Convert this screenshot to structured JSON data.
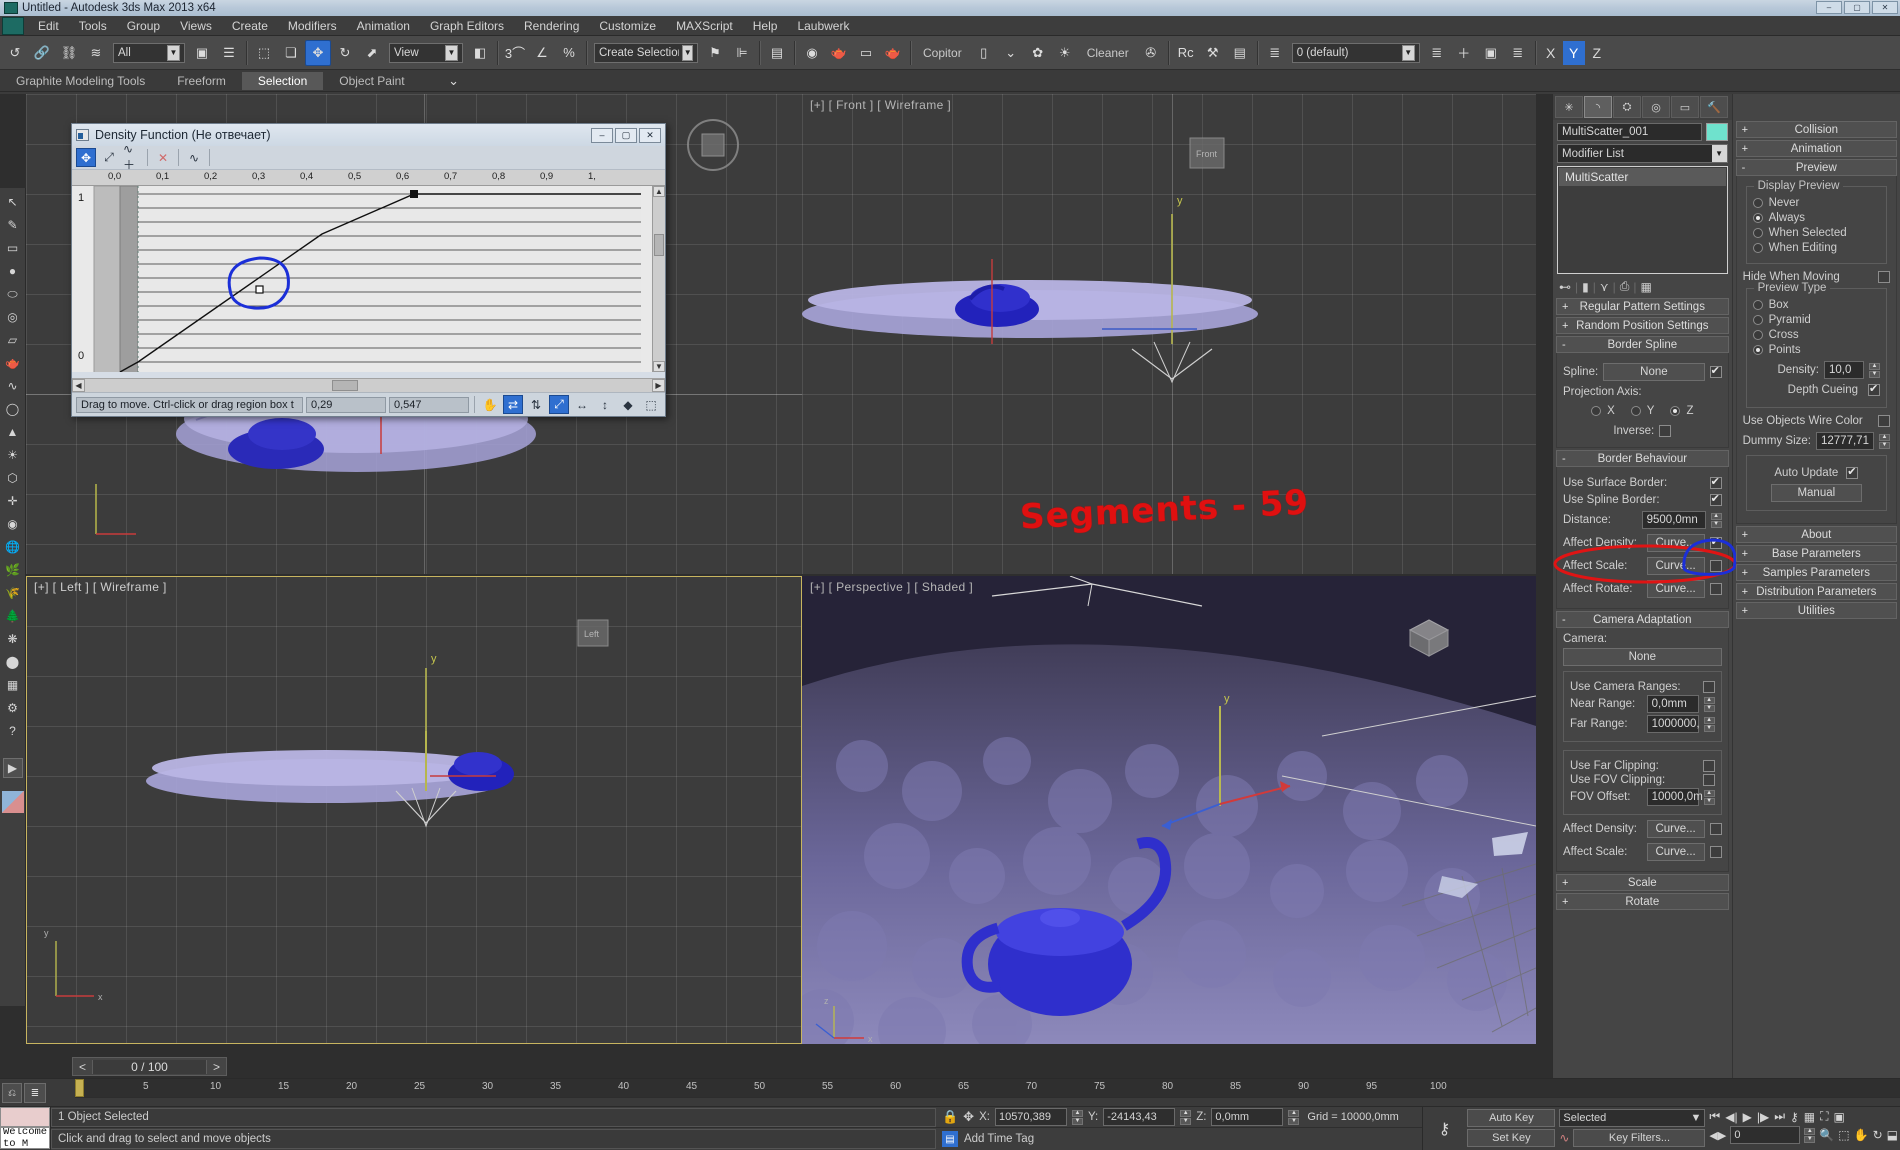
{
  "window": {
    "title": "Untitled - Autodesk 3ds Max  2013 x64",
    "buttons": [
      "–",
      "▢",
      "✕"
    ]
  },
  "menu": {
    "items": [
      "Edit",
      "Tools",
      "Group",
      "Views",
      "Create",
      "Modifiers",
      "Animation",
      "Graph Editors",
      "Rendering",
      "Customize",
      "MAXScript",
      "Help",
      "Laubwerk"
    ]
  },
  "toolbar": {
    "filter_combo": "All",
    "ref_coord_combo": "View",
    "selection_set_combo": "Create Selection Se",
    "layer_combo": "0 (default)",
    "plugin_labels": {
      "copitor": "Copitor",
      "cleaner": "Cleaner"
    },
    "axis": {
      "x": "X",
      "y": "Y",
      "z": "Z"
    },
    "icons": [
      "link-icon",
      "unlink-icon",
      "bind-spacewarp-icon",
      "select-object-icon",
      "select-by-name-icon",
      "rect-select-region-icon",
      "window-crossing-icon",
      "select-move-icon",
      "select-rotate-icon",
      "select-scale-icon",
      "snap-toggle-icon",
      "angle-snap-icon",
      "percent-snap-icon",
      "named-selection-sets-icon",
      "mirror-icon",
      "align-icon",
      "layer-manager-icon",
      "material-editor-icon",
      "render-setup-icon",
      "render-frame-icon",
      "render-production-icon",
      "curve-editor-icon",
      "schematic-view-icon",
      "manage-layers-icon",
      "add-layer-icon",
      "select-layer-icon",
      "layer-properties-icon"
    ]
  },
  "ribbon": {
    "tabs": [
      {
        "label": "Graphite Modeling Tools",
        "selected": false
      },
      {
        "label": "Freeform",
        "selected": false
      },
      {
        "label": "Selection",
        "selected": true
      },
      {
        "label": "Object Paint",
        "selected": false
      }
    ]
  },
  "dialog": {
    "title": "Density Function (Не отвечает)",
    "window_buttons": [
      "–",
      "▢",
      "✕"
    ],
    "toolbar_icons": [
      "move-key-icon",
      "scale-key-icon",
      "add-point-icon",
      "delete-point-icon",
      "apply-curve-icon"
    ],
    "ruler_ticks": [
      "0,0",
      "0,1",
      "0,2",
      "0,3",
      "0,4",
      "0,5",
      "0,6",
      "0,7",
      "0,8",
      "0,9",
      "1,"
    ],
    "y_axis_labels": [
      "1",
      "0"
    ],
    "status_hint": "Drag to move. Ctrl-click or drag region box t",
    "x_value": "0,29",
    "y_value": "0,547",
    "status_icons": [
      "pan-icon",
      "zoom-horizontal-icon",
      "zoom-vertical-icon",
      "zoom-region-icon",
      "frame-horizontal-icon",
      "frame-vertical-icon",
      "zoom-value-icon",
      "zoom-region-box-icon"
    ],
    "curve_points": [
      {
        "x": 0.0,
        "y": 0.0,
        "selected": false
      },
      {
        "x": 0.29,
        "y": 0.547,
        "selected": true
      },
      {
        "x": 0.5,
        "y": 1.0,
        "selected": false
      },
      {
        "x": 1.0,
        "y": 1.0,
        "selected": false
      }
    ]
  },
  "viewports": [
    {
      "name": "top-left",
      "label": "",
      "active": false
    },
    {
      "name": "front",
      "label": "[+] [ Front ] [ Wireframe ]",
      "active": false
    },
    {
      "name": "left",
      "label": "[+] [ Left ] [ Wireframe ]",
      "active": true
    },
    {
      "name": "perspective",
      "label": "[+] [ Perspective ] [ Shaded ]",
      "active": false
    }
  ],
  "annotations": {
    "handwritten_red": "Segments - 59",
    "circle_red_target": "affect-density-row",
    "circle_blue_target": "affect-density-checkbox"
  },
  "command_panel": {
    "tabs": [
      "create-tab",
      "modify-tab",
      "hierarchy-tab",
      "motion-tab",
      "display-tab",
      "utilities-tab"
    ],
    "selected_tab_index": 1,
    "object_name": "MultiScatter_001",
    "object_color": "#6fe2cd",
    "modifier_list_label": "Modifier List",
    "modifier_stack": [
      "MultiScatter"
    ],
    "stack_icons": [
      "pin-stack-icon",
      "show-end-result-icon",
      "make-unique-icon",
      "remove-modifier-icon",
      "configure-modifier-sets-icon"
    ],
    "left_rollups": [
      {
        "label": "Regular Pattern Settings",
        "state": "+"
      },
      {
        "label": "Random Position Settings",
        "state": "+"
      },
      {
        "label": "Border Spline",
        "state": "-"
      }
    ],
    "border_spline": {
      "spline_label": "Spline:",
      "spline_value": "None",
      "spline_checked": true,
      "projection_axis_label": "Projection Axis:",
      "axis_options": [
        "X",
        "Y",
        "Z"
      ],
      "axis_selected": "Z",
      "inverse_label": "Inverse:",
      "inverse_checked": false
    },
    "border_behaviour": {
      "title": "Border Behaviour",
      "state": "-",
      "use_surface_border": {
        "label": "Use Surface Border:",
        "checked": true
      },
      "use_spline_border": {
        "label": "Use Spline Border:",
        "checked": true
      },
      "distance": {
        "label": "Distance:",
        "value": "9500,0mn"
      },
      "affect_density": {
        "label": "Affect Density:",
        "value": "Curve...",
        "checked": true
      },
      "affect_scale": {
        "label": "Affect Scale:",
        "value": "Curve...",
        "checked": false
      },
      "affect_rotate": {
        "label": "Affect Rotate:",
        "value": "Curve...",
        "checked": false
      }
    },
    "camera_adaptation": {
      "title": "Camera Adaptation",
      "state": "-",
      "camera_label": "Camera:",
      "camera_value": "None",
      "use_camera_ranges": {
        "label": "Use Camera Ranges:",
        "checked": false
      },
      "near_range": {
        "label": "Near Range:",
        "value": "0,0mm"
      },
      "far_range": {
        "label": "Far Range:",
        "value": "1000000,"
      },
      "use_far_clipping": {
        "label": "Use Far Clipping:",
        "checked": false
      },
      "use_fov_clipping": {
        "label": "Use FOV Clipping:",
        "checked": false
      },
      "fov_offset": {
        "label": "FOV Offset:",
        "value": "10000,0m"
      },
      "affect_density": {
        "label": "Affect Density:",
        "value": "Curve...",
        "checked": false
      },
      "affect_scale": {
        "label": "Affect Scale:",
        "value": "Curve...",
        "checked": false
      }
    },
    "scale_rollup": {
      "label": "Scale",
      "state": "+"
    },
    "rotate_rollup": {
      "label": "Rotate",
      "state": "+"
    },
    "right_rollups_top": [
      {
        "label": "Collision",
        "state": "+"
      },
      {
        "label": "Animation",
        "state": "+"
      },
      {
        "label": "Preview",
        "state": "-"
      }
    ],
    "preview": {
      "display_preview_group": "Display Preview",
      "display_options": [
        {
          "label": "Never",
          "selected": false
        },
        {
          "label": "Always",
          "selected": true
        },
        {
          "label": "When Selected",
          "selected": false
        },
        {
          "label": "When Editing",
          "selected": false
        }
      ],
      "hide_when_moving": {
        "label": "Hide When Moving",
        "checked": false
      },
      "preview_type_group": "Preview Type",
      "type_options": [
        {
          "label": "Box",
          "selected": false
        },
        {
          "label": "Pyramid",
          "selected": false
        },
        {
          "label": "Cross",
          "selected": false
        },
        {
          "label": "Points",
          "selected": true
        }
      ],
      "density": {
        "label": "Density:",
        "value": "10,0"
      },
      "depth_cueing": {
        "label": "Depth Cueing",
        "checked": true
      },
      "use_objects_wire_color": {
        "label": "Use Objects Wire Color",
        "checked": false
      },
      "dummy_size": {
        "label": "Dummy Size:",
        "value": "12777,71"
      },
      "auto_update": {
        "label": "Auto Update",
        "checked": true
      },
      "manual_button": "Manual"
    },
    "right_rollups_bottom": [
      {
        "label": "About",
        "state": "+"
      },
      {
        "label": "Base Parameters",
        "state": "+"
      },
      {
        "label": "Samples Parameters",
        "state": "+"
      },
      {
        "label": "Distribution Parameters",
        "state": "+"
      },
      {
        "label": "Utilities",
        "state": "+"
      }
    ]
  },
  "timeline": {
    "frame_indicator": "0 / 100",
    "prev_label": "<",
    "next_label": ">",
    "ticks": [
      "0",
      "5",
      "10",
      "15",
      "20",
      "25",
      "30",
      "35",
      "40",
      "45",
      "50",
      "55",
      "60",
      "65",
      "70",
      "75",
      "80",
      "85",
      "90",
      "95",
      "100"
    ]
  },
  "status_bar": {
    "maxscript_prompt": "Welcome to M",
    "selection_status": "1 Object Selected",
    "hint": "Click and drag to select and move objects",
    "coord_x_label": "X:",
    "coord_x": "10570,389",
    "coord_y_label": "Y:",
    "coord_y": "-24143,43",
    "coord_z_label": "Z:",
    "coord_z": "0,0mm",
    "grid_text": "Grid = 10000,0mm",
    "add_time_tag": "Add Time Tag",
    "auto_key": "Auto Key",
    "set_key": "Set Key",
    "key_mode_combo": "Selected",
    "key_filters": "Key Filters...",
    "key_frame_value": "0"
  }
}
